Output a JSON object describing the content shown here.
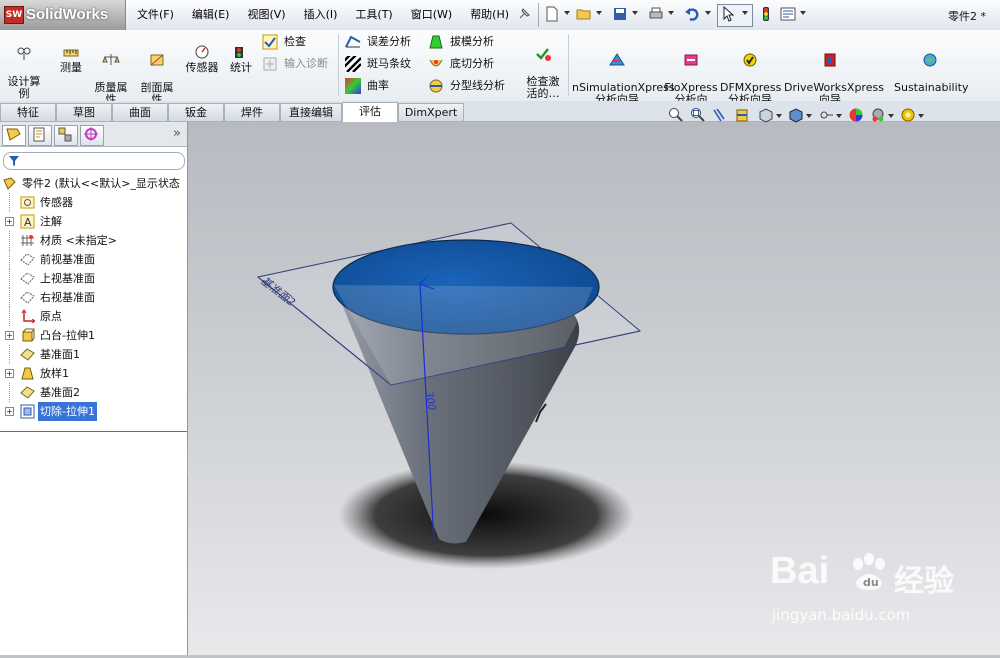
{
  "app": {
    "logo_text": "SolidWorks",
    "doc_title": "零件2 *"
  },
  "menu": [
    "文件(F)",
    "编辑(E)",
    "视图(V)",
    "插入(I)",
    "工具(T)",
    "窗口(W)",
    "帮助(H)"
  ],
  "ribbon": {
    "buttons": [
      {
        "label": "设计算\n例",
        "icon": "design-study-icon"
      },
      {
        "label": "测量",
        "icon": "measure-icon"
      },
      {
        "label": "质量属\n性",
        "icon": "mass-properties-icon"
      },
      {
        "label": "剖面属\n性",
        "icon": "section-properties-icon"
      },
      {
        "label": "传感器",
        "icon": "sensor-icon"
      },
      {
        "label": "统计",
        "icon": "statistics-icon"
      }
    ],
    "small": [
      {
        "label": "检查",
        "icon": "check-icon",
        "enabled": true
      },
      {
        "label": "输入诊断",
        "icon": "import-diagnostics-icon",
        "enabled": false
      },
      {
        "label": "误差分析",
        "icon": "deviation-analysis-icon",
        "enabled": true
      },
      {
        "label": "斑马条纹",
        "icon": "zebra-stripes-icon",
        "enabled": true
      },
      {
        "label": "曲率",
        "icon": "curvature-icon",
        "enabled": true
      },
      {
        "label": "拔模分析",
        "icon": "draft-analysis-icon",
        "enabled": true
      },
      {
        "label": "底切分析",
        "icon": "undercut-analysis-icon",
        "enabled": true
      },
      {
        "label": "分型线分析",
        "icon": "parting-line-icon",
        "enabled": true
      }
    ],
    "check_active": "检查激\n活的…",
    "xpress": [
      {
        "label": "nSimulationXpress\n分析向导",
        "icon": "simulationxpress-icon"
      },
      {
        "label": "FloXpress\n分析向\n导",
        "icon": "floxpress-icon"
      },
      {
        "label": "DFMXpress\n分析向导",
        "icon": "dfmxpress-icon"
      },
      {
        "label": "DriveWorksXpress\n向导",
        "icon": "driveworksxpress-icon"
      },
      {
        "label": "Sustainability",
        "icon": "sustainability-icon"
      }
    ]
  },
  "tabs": [
    "特征",
    "草图",
    "曲面",
    "钣金",
    "焊件",
    "直接编辑",
    "评估",
    "DimXpert"
  ],
  "active_tab": "评估",
  "tree": [
    {
      "label": "零件2 (默认<<默认>_显示状态",
      "icon": "part-icon",
      "expand": false,
      "root": true
    },
    {
      "label": "传感器",
      "icon": "sensor-folder-icon",
      "expand": false
    },
    {
      "label": "注解",
      "icon": "annotation-icon",
      "expand": true
    },
    {
      "label": "材质 <未指定>",
      "icon": "material-icon",
      "expand": false
    },
    {
      "label": "前视基准面",
      "icon": "plane-icon",
      "expand": false
    },
    {
      "label": "上视基准面",
      "icon": "plane-icon",
      "expand": false
    },
    {
      "label": "右视基准面",
      "icon": "plane-icon",
      "expand": false
    },
    {
      "label": "原点",
      "icon": "origin-icon",
      "expand": false
    },
    {
      "label": "凸台-拉伸1",
      "icon": "boss-extrude-icon",
      "expand": true
    },
    {
      "label": "基准面1",
      "icon": "plane-icon",
      "expand": false
    },
    {
      "label": "放样1",
      "icon": "loft-icon",
      "expand": true
    },
    {
      "label": "基准面2",
      "icon": "plane-icon",
      "expand": false
    },
    {
      "label": "切除-拉伸1",
      "icon": "cut-extrude-icon",
      "expand": true,
      "selected": true
    }
  ],
  "viewport": {
    "plane_label": "基准面2",
    "dimension": "300"
  },
  "watermark": {
    "line1": "Bai",
    "line2": "经验",
    "url": "jingyan.baidu.com"
  },
  "colors": {
    "selection": "#3874d8",
    "top_face": "#1457a8",
    "cone": "#5e6470",
    "accent": "#c62a24"
  }
}
